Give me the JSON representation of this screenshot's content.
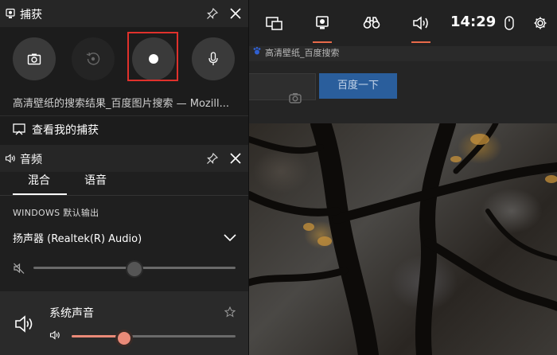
{
  "browser": {
    "tab_title": "高清壁纸_百度搜索",
    "search_button": "百度一下"
  },
  "topbar": {
    "time": "14:29",
    "icons": [
      "widget-menu-icon",
      "capture-widget-icon",
      "looking-for-group-icon",
      "audio-widget-icon",
      "mouse-icon",
      "settings-icon"
    ],
    "accent_color": "#e86a4a"
  },
  "capture": {
    "title": "捕获",
    "window_name": "高清壁纸的搜索结果_百度图片搜索 — Mozill...",
    "gallery_label": "查看我的捕获"
  },
  "audio": {
    "title": "音频",
    "tabs": [
      "混合",
      "语音"
    ],
    "output_caption": "WINDOWS 默认输出",
    "device": "扬声器 (Realtek(R) Audio)",
    "master_volume": 0.5,
    "app": {
      "name": "系统声音",
      "volume": 0.32
    },
    "accent_color": "#ea8a78"
  }
}
